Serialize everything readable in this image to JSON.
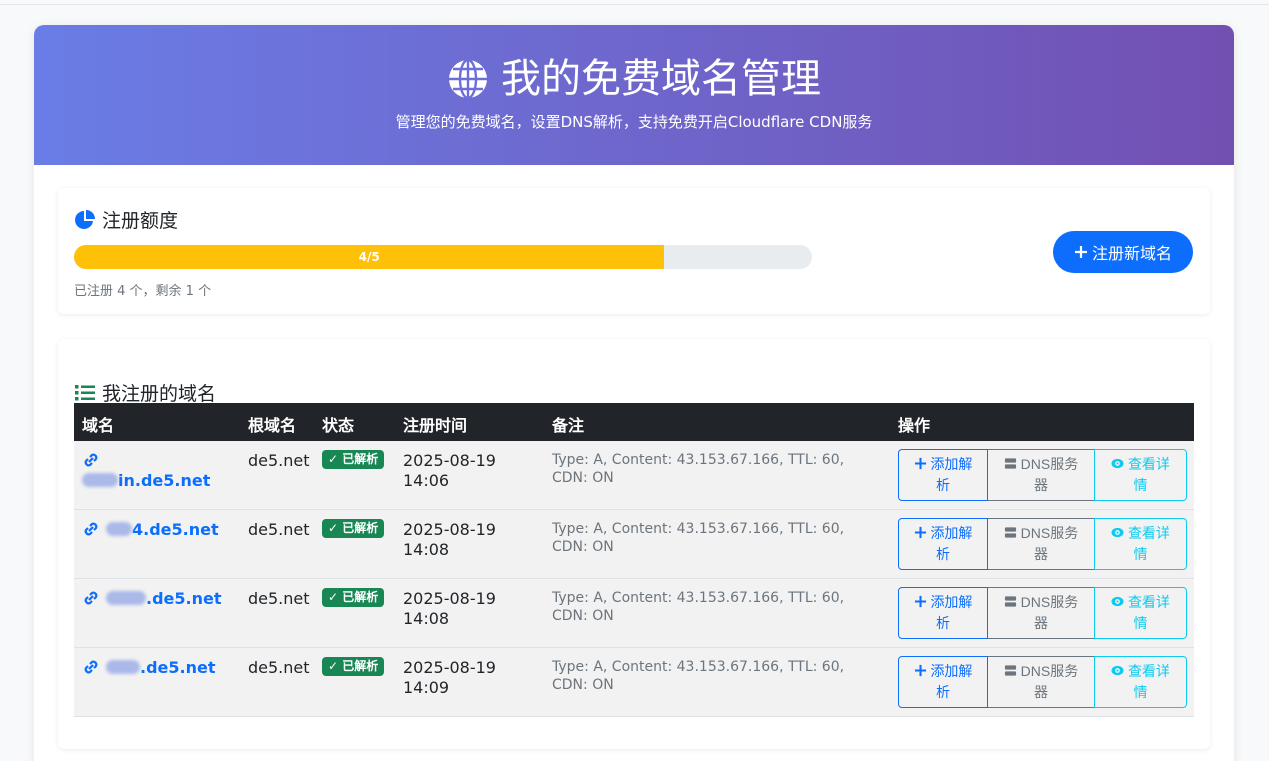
{
  "header": {
    "title": "我的免费域名管理",
    "subtitle": "管理您的免费域名，设置DNS解析，支持免费开启Cloudflare CDN服务"
  },
  "quota": {
    "title": "注册额度",
    "progress_label": "4/5",
    "progress_value": 0.8,
    "note": "已注册 4 个，剩余 1 个",
    "register_button": "注册新域名"
  },
  "domains": {
    "title": "我注册的域名",
    "columns": [
      "域名",
      "根域名",
      "状态",
      "注册时间",
      "备注",
      "操作"
    ],
    "rows": [
      {
        "domain_suffix": "in.de5.net",
        "root": "de5.net",
        "status": "已解析",
        "date": "2025-08-19",
        "time": "14:06",
        "note": "Type: A, Content: 43.153.67.166, TTL: 60, CDN: ON"
      },
      {
        "domain_suffix": "4.de5.net",
        "root": "de5.net",
        "status": "已解析",
        "date": "2025-08-19",
        "time": "14:08",
        "note": "Type: A, Content: 43.153.67.166, TTL: 60, CDN: ON"
      },
      {
        "domain_suffix": ".de5.net",
        "root": "de5.net",
        "status": "已解析",
        "date": "2025-08-19",
        "time": "14:08",
        "note": "Type: A, Content: 43.153.67.166, TTL: 60, CDN: ON"
      },
      {
        "domain_suffix": ".de5.net",
        "root": "de5.net",
        "status": "已解析",
        "date": "2025-08-19",
        "time": "14:09",
        "note": "Type: A, Content: 43.153.67.166, TTL: 60, CDN: ON"
      }
    ],
    "actions": {
      "add_line1": "添加解",
      "add_line2": "析",
      "dns_line1": "DNS服务",
      "dns_line2": "器",
      "view_line1": "查看详",
      "view_line2": "情"
    }
  },
  "colors": {
    "primary": "#0d6efd",
    "success": "#198754",
    "warning": "#ffc107",
    "info": "#0dcaf0",
    "dark": "#212529"
  }
}
